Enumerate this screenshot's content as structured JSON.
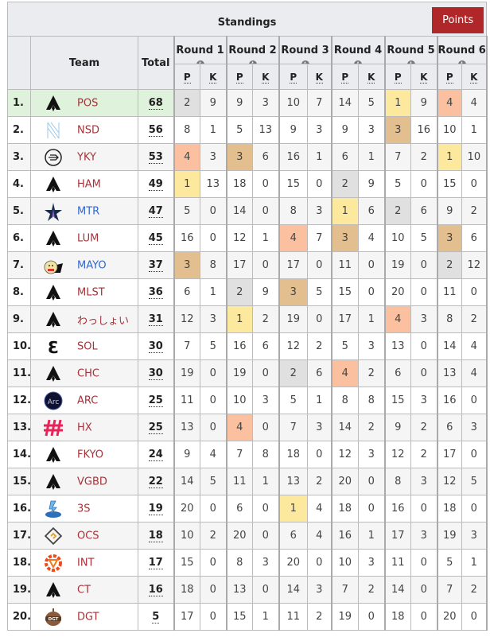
{
  "header": {
    "title": "Standings",
    "points_button": "Points"
  },
  "columns": {
    "team": "Team",
    "total": "Total",
    "rounds": [
      "Round 1",
      "Round 2",
      "Round 3",
      "Round 4",
      "Round 5",
      "Round 6"
    ],
    "placement": "P",
    "kills": "K",
    "info_icon": "info-icon"
  },
  "placement_colors": {
    "1": "#fde99e",
    "2": "#e0e0e0",
    "3": "#e3be8f",
    "4": "#fbc0a0",
    "leader_row": "#dff3dc",
    "link_red": "#a2343a",
    "link_blue": "#3366cc",
    "points_button": "#b0272a"
  },
  "teams": [
    {
      "rank": "1.",
      "name": "POS",
      "logo": "apex-logo",
      "link": "red",
      "total": "68",
      "rounds": [
        [
          2,
          9
        ],
        [
          9,
          3
        ],
        [
          10,
          7
        ],
        [
          14,
          5
        ],
        [
          1,
          9
        ],
        [
          4,
          4
        ]
      ]
    },
    {
      "rank": "2.",
      "name": "NSD",
      "logo": "nsd-logo",
      "link": "red",
      "total": "56",
      "rounds": [
        [
          8,
          1
        ],
        [
          5,
          13
        ],
        [
          9,
          3
        ],
        [
          9,
          3
        ],
        [
          3,
          16
        ],
        [
          10,
          1
        ]
      ]
    },
    {
      "rank": "3.",
      "name": "YKY",
      "logo": "yky-logo",
      "link": "red",
      "total": "53",
      "rounds": [
        [
          4,
          3
        ],
        [
          3,
          6
        ],
        [
          16,
          1
        ],
        [
          6,
          1
        ],
        [
          7,
          2
        ],
        [
          1,
          10
        ]
      ]
    },
    {
      "rank": "4.",
      "name": "HAM",
      "logo": "apex-logo",
      "link": "red",
      "total": "49",
      "rounds": [
        [
          1,
          13
        ],
        [
          18,
          0
        ],
        [
          15,
          0
        ],
        [
          2,
          9
        ],
        [
          5,
          0
        ],
        [
          15,
          0
        ]
      ]
    },
    {
      "rank": "5.",
      "name": "MTR",
      "logo": "mtr-logo",
      "link": "blue",
      "total": "47",
      "rounds": [
        [
          5,
          0
        ],
        [
          14,
          0
        ],
        [
          8,
          3
        ],
        [
          1,
          6
        ],
        [
          2,
          6
        ],
        [
          9,
          2
        ]
      ]
    },
    {
      "rank": "6.",
      "name": "LUM",
      "logo": "apex-logo",
      "link": "red",
      "total": "45",
      "rounds": [
        [
          16,
          0
        ],
        [
          12,
          1
        ],
        [
          4,
          7
        ],
        [
          3,
          4
        ],
        [
          10,
          5
        ],
        [
          3,
          6
        ]
      ]
    },
    {
      "rank": "7.",
      "name": "MAYO",
      "logo": "mayo-logo",
      "link": "blue",
      "total": "37",
      "rounds": [
        [
          3,
          8
        ],
        [
          17,
          0
        ],
        [
          17,
          0
        ],
        [
          11,
          0
        ],
        [
          19,
          0
        ],
        [
          2,
          12
        ]
      ]
    },
    {
      "rank": "8.",
      "name": "MLST",
      "logo": "apex-logo",
      "link": "red",
      "total": "36",
      "rounds": [
        [
          6,
          1
        ],
        [
          2,
          9
        ],
        [
          3,
          5
        ],
        [
          15,
          0
        ],
        [
          20,
          0
        ],
        [
          11,
          0
        ]
      ]
    },
    {
      "rank": "9.",
      "name": "わっしょい",
      "logo": "apex-logo",
      "link": "red",
      "total": "31",
      "rounds": [
        [
          12,
          3
        ],
        [
          1,
          2
        ],
        [
          19,
          0
        ],
        [
          17,
          1
        ],
        [
          4,
          3
        ],
        [
          8,
          2
        ]
      ]
    },
    {
      "rank": "10.",
      "name": "SOL",
      "logo": "sol-logo",
      "link": "red",
      "total": "30",
      "rounds": [
        [
          7,
          5
        ],
        [
          16,
          6
        ],
        [
          12,
          2
        ],
        [
          5,
          3
        ],
        [
          13,
          0
        ],
        [
          14,
          4
        ]
      ]
    },
    {
      "rank": "11.",
      "name": "CHC",
      "logo": "apex-logo",
      "link": "red",
      "total": "30",
      "rounds": [
        [
          19,
          0
        ],
        [
          19,
          0
        ],
        [
          2,
          6
        ],
        [
          4,
          2
        ],
        [
          6,
          0
        ],
        [
          13,
          4
        ]
      ]
    },
    {
      "rank": "12.",
      "name": "ARC",
      "logo": "arc-logo",
      "link": "red",
      "total": "25",
      "rounds": [
        [
          11,
          0
        ],
        [
          10,
          3
        ],
        [
          5,
          1
        ],
        [
          8,
          8
        ],
        [
          15,
          3
        ],
        [
          16,
          0
        ]
      ]
    },
    {
      "rank": "13.",
      "name": "HX",
      "logo": "hx-logo",
      "link": "red",
      "total": "25",
      "rounds": [
        [
          13,
          0
        ],
        [
          4,
          0
        ],
        [
          7,
          3
        ],
        [
          14,
          2
        ],
        [
          9,
          2
        ],
        [
          6,
          3
        ]
      ]
    },
    {
      "rank": "14.",
      "name": "FKYO",
      "logo": "apex-logo",
      "link": "red",
      "total": "24",
      "rounds": [
        [
          9,
          4
        ],
        [
          7,
          8
        ],
        [
          18,
          0
        ],
        [
          12,
          3
        ],
        [
          12,
          2
        ],
        [
          17,
          0
        ]
      ]
    },
    {
      "rank": "15.",
      "name": "VGBD",
      "logo": "apex-logo",
      "link": "red",
      "total": "22",
      "rounds": [
        [
          14,
          5
        ],
        [
          11,
          1
        ],
        [
          13,
          2
        ],
        [
          20,
          0
        ],
        [
          8,
          3
        ],
        [
          12,
          5
        ]
      ]
    },
    {
      "rank": "16.",
      "name": "3S",
      "logo": "3s-logo",
      "link": "red",
      "total": "19",
      "rounds": [
        [
          20,
          0
        ],
        [
          6,
          0
        ],
        [
          1,
          4
        ],
        [
          18,
          0
        ],
        [
          16,
          0
        ],
        [
          18,
          0
        ]
      ]
    },
    {
      "rank": "17.",
      "name": "OCS",
      "logo": "ocs-logo",
      "link": "red",
      "total": "18",
      "rounds": [
        [
          10,
          2
        ],
        [
          20,
          0
        ],
        [
          6,
          4
        ],
        [
          16,
          1
        ],
        [
          17,
          3
        ],
        [
          19,
          3
        ]
      ]
    },
    {
      "rank": "18.",
      "name": "INT",
      "logo": "int-logo",
      "link": "red",
      "total": "17",
      "rounds": [
        [
          15,
          0
        ],
        [
          8,
          3
        ],
        [
          20,
          0
        ],
        [
          10,
          3
        ],
        [
          11,
          0
        ],
        [
          5,
          1
        ]
      ]
    },
    {
      "rank": "19.",
      "name": "CT",
      "logo": "apex-logo",
      "link": "red",
      "total": "16",
      "rounds": [
        [
          18,
          0
        ],
        [
          13,
          0
        ],
        [
          14,
          3
        ],
        [
          7,
          2
        ],
        [
          14,
          0
        ],
        [
          7,
          2
        ]
      ]
    },
    {
      "rank": "20.",
      "name": "DGT",
      "logo": "dgt-logo",
      "link": "red",
      "total": "5",
      "rounds": [
        [
          17,
          0
        ],
        [
          15,
          1
        ],
        [
          11,
          2
        ],
        [
          19,
          0
        ],
        [
          18,
          0
        ],
        [
          20,
          0
        ]
      ]
    }
  ]
}
